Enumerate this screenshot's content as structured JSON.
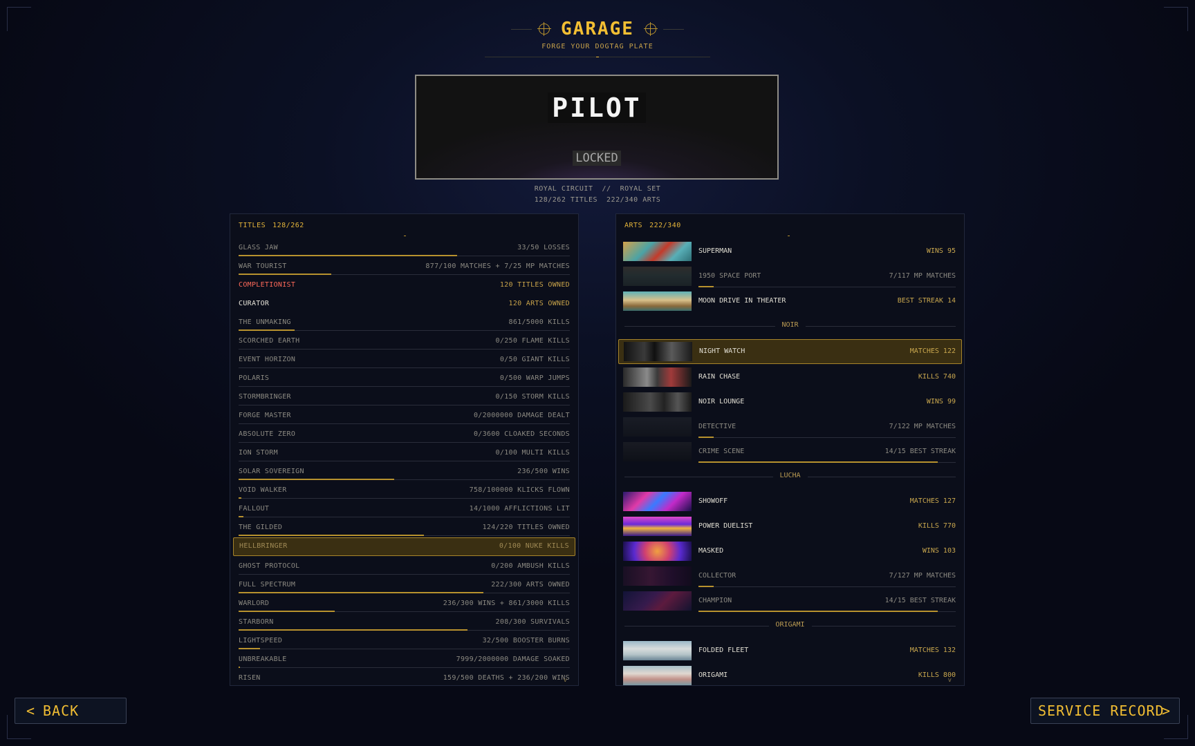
{
  "header": {
    "title": "GARAGE",
    "subtitle": "FORGE YOUR DOGTAG PLATE"
  },
  "plate": {
    "name": "PILOT",
    "status": "LOCKED",
    "info_line1": "ROYAL CIRCUIT  //  ROYAL SET",
    "info_line2": "128/262 TITLES  222/340 ARTS"
  },
  "titles_panel": {
    "label": "TITLES",
    "count": "128/262",
    "rows": [
      {
        "name": "GLASS JAW",
        "value": "33/50 LOSSES",
        "progress": 0.66,
        "style": "normal"
      },
      {
        "name": "WAR TOURIST",
        "value": "877/100 MATCHES + 7/25 MP MATCHES",
        "progress": 0.28,
        "style": "normal"
      },
      {
        "name": "COMPLETIONIST",
        "value": "120 TITLES OWNED",
        "progress": 1,
        "style": "red-owned"
      },
      {
        "name": "CURATOR",
        "value": "120 ARTS OWNED",
        "progress": 1,
        "style": "white-owned"
      },
      {
        "name": "THE UNMAKING",
        "value": "861/5000 KILLS",
        "progress": 0.17,
        "style": "normal"
      },
      {
        "name": "SCORCHED EARTH",
        "value": "0/250 FLAME KILLS",
        "progress": 0,
        "style": "normal"
      },
      {
        "name": "EVENT HORIZON",
        "value": "0/50 GIANT KILLS",
        "progress": 0,
        "style": "normal"
      },
      {
        "name": "POLARIS",
        "value": "0/500 WARP JUMPS",
        "progress": 0,
        "style": "normal"
      },
      {
        "name": "STORMBRINGER",
        "value": "0/150 STORM KILLS",
        "progress": 0,
        "style": "normal"
      },
      {
        "name": "FORGE MASTER",
        "value": "0/2000000 DAMAGE DEALT",
        "progress": 0,
        "style": "normal"
      },
      {
        "name": "ABSOLUTE ZERO",
        "value": "0/3600 CLOAKED SECONDS",
        "progress": 0,
        "style": "normal"
      },
      {
        "name": "ION STORM",
        "value": "0/100 MULTI KILLS",
        "progress": 0,
        "style": "normal"
      },
      {
        "name": "SOLAR SOVEREIGN",
        "value": "236/500 WINS",
        "progress": 0.47,
        "style": "normal"
      },
      {
        "name": "VOID WALKER",
        "value": "758/100000 KLICKS FLOWN",
        "progress": 0.008,
        "style": "normal"
      },
      {
        "name": "FALLOUT",
        "value": "14/1000 AFFLICTIONS LIT",
        "progress": 0.014,
        "style": "normal"
      },
      {
        "name": "THE GILDED",
        "value": "124/220 TITLES OWNED",
        "progress": 0.56,
        "style": "normal"
      },
      {
        "name": "HELLBRINGER",
        "value": "0/100 NUKE KILLS",
        "progress": 0,
        "style": "selected"
      },
      {
        "name": "GHOST PROTOCOL",
        "value": "0/200 AMBUSH KILLS",
        "progress": 0,
        "style": "normal"
      },
      {
        "name": "FULL SPECTRUM",
        "value": "222/300 ARTS OWNED",
        "progress": 0.74,
        "style": "normal"
      },
      {
        "name": "WARLORD",
        "value": "236/300 WINS + 861/3000 KILLS",
        "progress": 0.29,
        "style": "normal"
      },
      {
        "name": "STARBORN",
        "value": "208/300 SURVIVALS",
        "progress": 0.69,
        "style": "normal"
      },
      {
        "name": "LIGHTSPEED",
        "value": "32/500 BOOSTER BURNS",
        "progress": 0.064,
        "style": "normal"
      },
      {
        "name": "UNBREAKABLE",
        "value": "7999/2000000 DAMAGE SOAKED",
        "progress": 0.004,
        "style": "normal"
      },
      {
        "name": "RISEN",
        "value": "159/500 DEATHS + 236/200 WINS",
        "progress": 0.32,
        "style": "normal"
      }
    ],
    "scroll_hint": "v"
  },
  "arts_panel": {
    "label": "ARTS",
    "count": "222/340",
    "items": [
      {
        "kind": "art",
        "name": "SUPERMAN",
        "value": "WINS 95",
        "thumb": "t-superman",
        "locked": false
      },
      {
        "kind": "art",
        "name": "1950 SPACE PORT",
        "value": "7/117 MP MATCHES",
        "thumb": "t-spaceport",
        "locked": true,
        "progress": 0.06
      },
      {
        "kind": "art",
        "name": "MOON DRIVE IN THEATER",
        "value": "BEST STREAK 14",
        "thumb": "t-moon",
        "locked": false
      },
      {
        "kind": "section",
        "label": "NOIR"
      },
      {
        "kind": "art",
        "name": "NIGHT WATCH",
        "value": "MATCHES 122",
        "thumb": "t-night",
        "locked": false,
        "selected": true
      },
      {
        "kind": "art",
        "name": "RAIN CHASE",
        "value": "KILLS 740",
        "thumb": "t-rain",
        "locked": false
      },
      {
        "kind": "art",
        "name": "NOIR LOUNGE",
        "value": "WINS 99",
        "thumb": "t-lounge",
        "locked": false
      },
      {
        "kind": "art",
        "name": "DETECTIVE",
        "value": "7/122 MP MATCHES",
        "thumb": "t-detective",
        "locked": true,
        "progress": 0.06
      },
      {
        "kind": "art",
        "name": "CRIME SCENE",
        "value": "14/15 BEST STREAK",
        "thumb": "t-crime",
        "locked": true,
        "progress": 0.93
      },
      {
        "kind": "section",
        "label": "LUCHA"
      },
      {
        "kind": "art",
        "name": "SHOWOFF",
        "value": "MATCHES 127",
        "thumb": "t-showoff",
        "locked": false
      },
      {
        "kind": "art",
        "name": "POWER DUELIST",
        "value": "KILLS 770",
        "thumb": "t-duelist",
        "locked": false
      },
      {
        "kind": "art",
        "name": "MASKED",
        "value": "WINS 103",
        "thumb": "t-masked",
        "locked": false
      },
      {
        "kind": "art",
        "name": "COLLECTOR",
        "value": "7/127 MP MATCHES",
        "thumb": "t-collector",
        "locked": true,
        "progress": 0.06
      },
      {
        "kind": "art",
        "name": "CHAMPION",
        "value": "14/15 BEST STREAK",
        "thumb": "t-champion",
        "locked": true,
        "progress": 0.93
      },
      {
        "kind": "section",
        "label": "ORIGAMI"
      },
      {
        "kind": "art",
        "name": "FOLDED FLEET",
        "value": "MATCHES 132",
        "thumb": "t-fleet",
        "locked": false
      },
      {
        "kind": "art",
        "name": "ORIGAMI",
        "value": "KILLS 800",
        "thumb": "t-origami",
        "locked": false
      }
    ],
    "scroll_hint": "v"
  },
  "buttons": {
    "back": {
      "label": "BACK",
      "icon": "chevron-left-icon",
      "glyph": "<"
    },
    "service_record": {
      "label": "SERVICE RECORD",
      "icon": "chevron-right-icon",
      "glyph": ">"
    }
  },
  "colors": {
    "accent": "#f2be33",
    "panel_bg": "#0b0e1a",
    "selected_bg": "#3a2f12",
    "red_title": "#ff6a5a"
  }
}
